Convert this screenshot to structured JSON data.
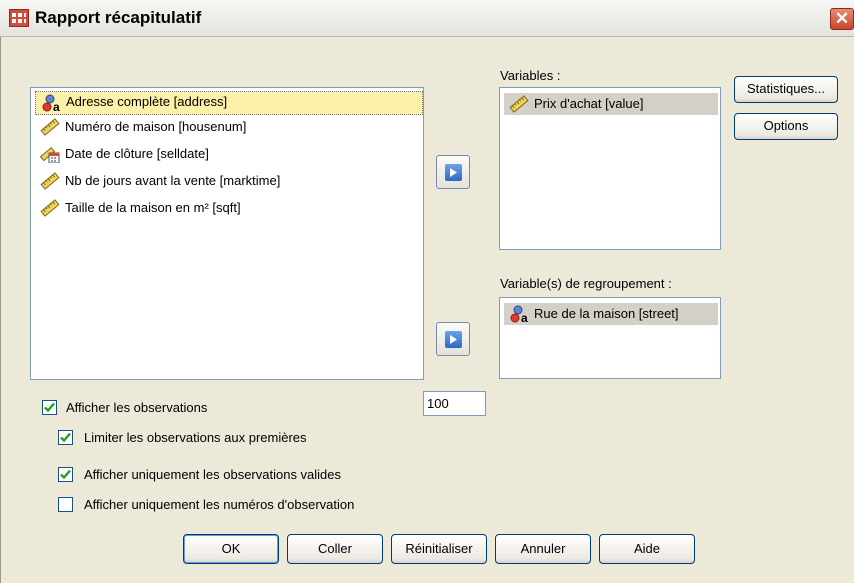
{
  "window": {
    "title": "Rapport récapitulatif",
    "close_label": "✕"
  },
  "source_list": {
    "items": [
      {
        "label": "Adresse complète [address]",
        "icon": "nominal-string-icon",
        "selected": true
      },
      {
        "label": "Numéro de maison [housenum]",
        "icon": "scale-ruler-icon"
      },
      {
        "label": "Date de clôture [selldate]",
        "icon": "scale-date-icon"
      },
      {
        "label": "Nb de jours avant la vente [marktime]",
        "icon": "scale-ruler-icon"
      },
      {
        "label": "Taille de la maison en m² [sqft]",
        "icon": "scale-ruler-icon"
      }
    ]
  },
  "variables": {
    "label": "Variables :",
    "items": [
      {
        "label": "Prix d'achat [value]",
        "icon": "scale-ruler-icon"
      }
    ]
  },
  "grouping": {
    "label": "Variable(s) de regroupement :",
    "items": [
      {
        "label": "Rue de la maison [street]",
        "icon": "nominal-string-icon"
      }
    ]
  },
  "side_buttons": {
    "statistics": "Statistiques...",
    "options": "Options"
  },
  "checkboxes": {
    "show_cases": {
      "label": "Afficher les observations",
      "checked": true
    },
    "limit_cases": {
      "label": "Limiter les observations aux premières",
      "checked": true,
      "value": "100"
    },
    "valid_only": {
      "label": "Afficher uniquement les observations valides",
      "checked": true
    },
    "case_numbers": {
      "label": "Afficher uniquement les numéros d'observation",
      "checked": false
    }
  },
  "footer": {
    "ok": "OK",
    "paste": "Coller",
    "reset": "Réinitialiser",
    "cancel": "Annuler",
    "help": "Aide"
  },
  "colors": {
    "selection": "#fdf0a8",
    "accent": "#2f68c4",
    "dialog_bg": "#ece9d8"
  }
}
